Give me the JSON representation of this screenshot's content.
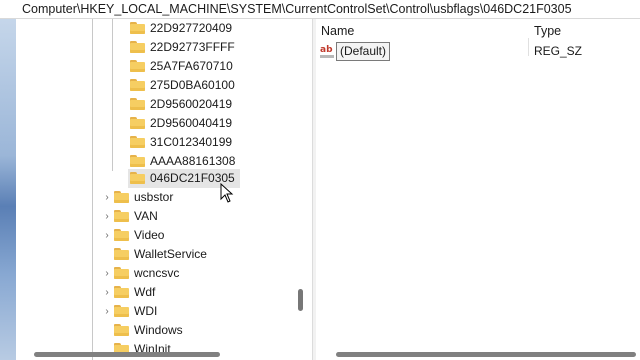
{
  "address_bar": {
    "path": "Computer\\HKEY_LOCAL_MACHINE\\SYSTEM\\CurrentControlSet\\Control\\usbflags\\046DC21F0305"
  },
  "tree": {
    "subkeys": [
      {
        "label": "22D927720409"
      },
      {
        "label": "22D92773FFFF"
      },
      {
        "label": "25A7FA670710"
      },
      {
        "label": "275D0BA60100"
      },
      {
        "label": "2D9560020419"
      },
      {
        "label": "2D9560040419"
      },
      {
        "label": "31C012340199"
      },
      {
        "label": "AAAA88161308"
      },
      {
        "label": "046DC21F0305",
        "selected": true
      }
    ],
    "keys": [
      {
        "label": "usbstor",
        "expandable": true
      },
      {
        "label": "VAN",
        "expandable": true
      },
      {
        "label": "Video",
        "expandable": true
      },
      {
        "label": "WalletService",
        "expandable": false
      },
      {
        "label": "wcncsvc",
        "expandable": true
      },
      {
        "label": "Wdf",
        "expandable": true
      },
      {
        "label": "WDI",
        "expandable": true
      },
      {
        "label": "Windows",
        "expandable": false
      },
      {
        "label": "WinInit",
        "expandable": false
      }
    ]
  },
  "values_pane": {
    "columns": {
      "name": "Name",
      "type": "Type"
    },
    "rows": [
      {
        "name": "(Default)",
        "type": "REG_SZ",
        "icon": "ab-string-icon"
      }
    ]
  },
  "colors": {
    "folder": "#f6ce62",
    "selection": "#e5e5e5"
  }
}
